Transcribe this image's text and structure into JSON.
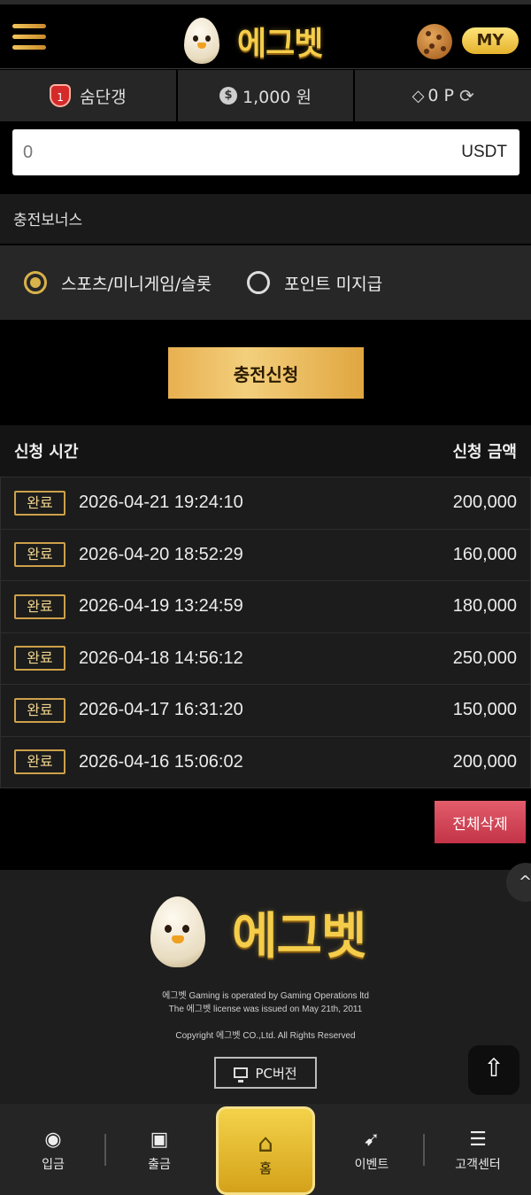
{
  "header": {
    "logo_text": "에그벳",
    "my_label": "MY"
  },
  "status": {
    "user_level": "1",
    "username": "숨단갱",
    "balance": "1,000 원",
    "points": "0 P"
  },
  "deposit": {
    "amount_value": "0",
    "currency": "USDT",
    "bonus_heading": "충전보너스",
    "bonus_options": [
      {
        "label": "스포츠/미니게임/슬롯",
        "checked": true
      },
      {
        "label": "포인트 미지급",
        "checked": false
      }
    ],
    "submit_label": "충전신청"
  },
  "history": {
    "col_time": "신청 시간",
    "col_amount": "신청 금액",
    "rows": [
      {
        "status": "완료",
        "datetime": "2026-04-21 19:24:10",
        "amount": "200,000"
      },
      {
        "status": "완료",
        "datetime": "2026-04-20 18:52:29",
        "amount": "160,000"
      },
      {
        "status": "완료",
        "datetime": "2026-04-19 13:24:59",
        "amount": "180,000"
      },
      {
        "status": "완료",
        "datetime": "2026-04-18 14:56:12",
        "amount": "250,000"
      },
      {
        "status": "완료",
        "datetime": "2026-04-17 16:31:20",
        "amount": "150,000"
      },
      {
        "status": "완료",
        "datetime": "2026-04-16 15:06:02",
        "amount": "200,000"
      }
    ],
    "delete_all_label": "전체삭제"
  },
  "footer": {
    "logo_text": "에그벳",
    "line1": "에그벳 Gaming is operated by Gaming Operations ltd",
    "line2": "The 에그벳 license was issued on May 21th, 2011",
    "copyright": "Copyright 에그벳 CO.,Ltd. All Rights Reserved",
    "pc_label": "PC버전"
  },
  "nav": {
    "deposit": "입금",
    "withdraw": "출금",
    "home": "홈",
    "event": "이벤트",
    "support": "고객센터"
  },
  "colors": {
    "gold": "#d8b24a",
    "danger": "#c33347",
    "background": "#000000"
  }
}
